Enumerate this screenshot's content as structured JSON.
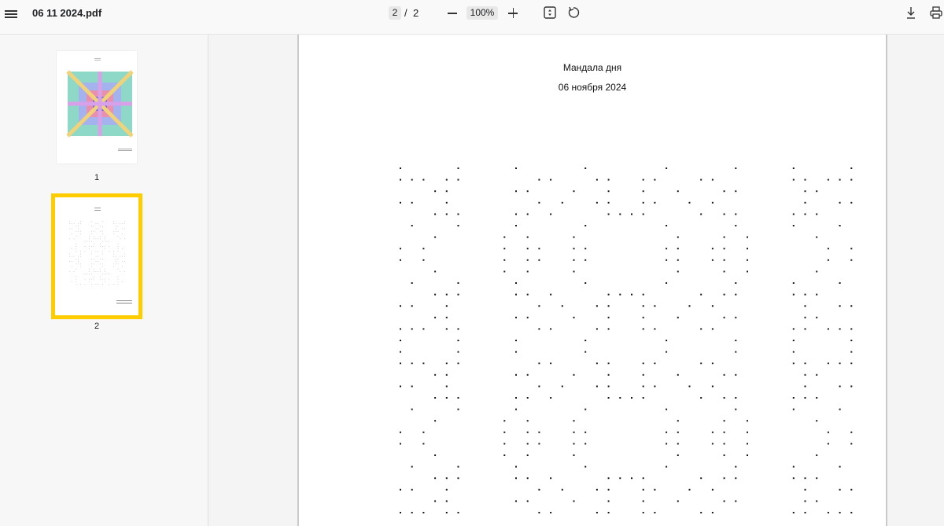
{
  "toolbar": {
    "filename": "06 11 2024.pdf",
    "current_page": "2",
    "separator": "/",
    "total_pages": "2",
    "zoom": "100%"
  },
  "sidebar": {
    "thumbnails": [
      {
        "label": "1"
      },
      {
        "label": "2",
        "selected": true
      }
    ]
  },
  "document": {
    "title": "Мандала дня",
    "date": "06 ноября 2024"
  },
  "colors": {
    "accent_selected": "#ffcc00",
    "dot": "#1a1a1a"
  }
}
